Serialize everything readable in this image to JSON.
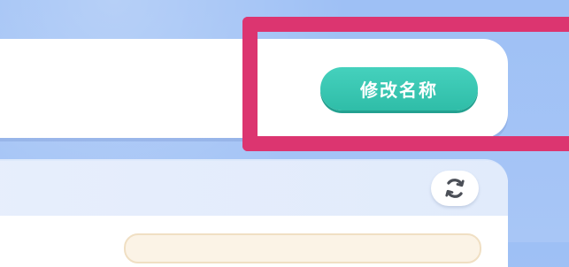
{
  "rename_card": {
    "rename_button_label": "修改名称"
  },
  "list_panel": {
    "refresh_icon": "refresh-icon"
  },
  "colors": {
    "background": "#a4c3f5",
    "button_teal": "#3ac7b3",
    "highlight_frame": "#dc3570",
    "panel_header": "#e4ecfb",
    "list_item": "#fbf3e6"
  }
}
